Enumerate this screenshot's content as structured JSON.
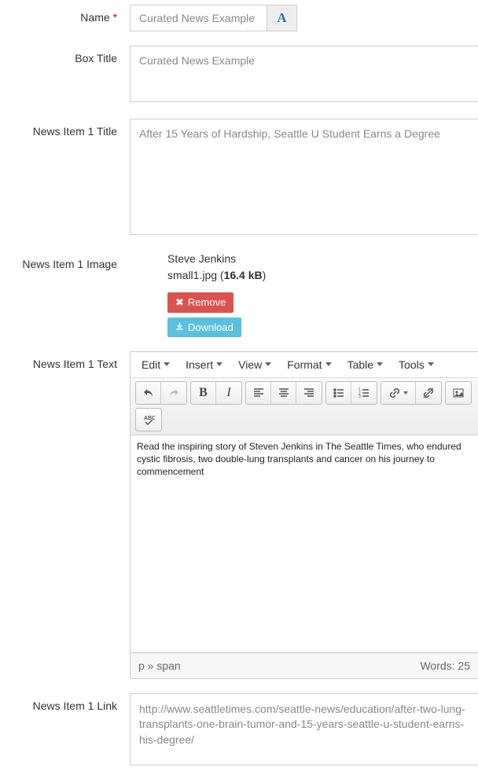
{
  "labels": {
    "name": "Name",
    "box_title": "Box Title",
    "item1_title": "News Item 1 Title",
    "item1_image": "News Item 1 Image",
    "item1_text": "News Item 1 Text",
    "item1_link": "News Item 1 Link"
  },
  "values": {
    "name": "Curated News Example",
    "box_title": "Curated News Example",
    "item1_title": "After 15 Years of Hardship, Seattle U Student Earns a Degree",
    "item1_link": "http://www.seattletimes.com/seattle-news/education/after-two-lung-transplants-one-brain-tumor-and-15-years-seattle-u-student-earns-his-degree/"
  },
  "image": {
    "author": "Steve Jenkins",
    "filename_prefix": "small1.jpg (",
    "filesize": "16.4 kB",
    "filename_suffix": ")",
    "remove_label": "Remove",
    "download_label": "Download"
  },
  "editor": {
    "menus": [
      "Edit",
      "Insert",
      "View",
      "Format",
      "Table",
      "Tools"
    ],
    "content": "Read the inspiring story of Steven Jenkins in The Seattle Times, who endured cystic fibrosis, two double-lung transplants and cancer on his journey to commencement",
    "status_path": "p » span",
    "status_words": "Words: 25"
  },
  "font_button_glyph": "A"
}
